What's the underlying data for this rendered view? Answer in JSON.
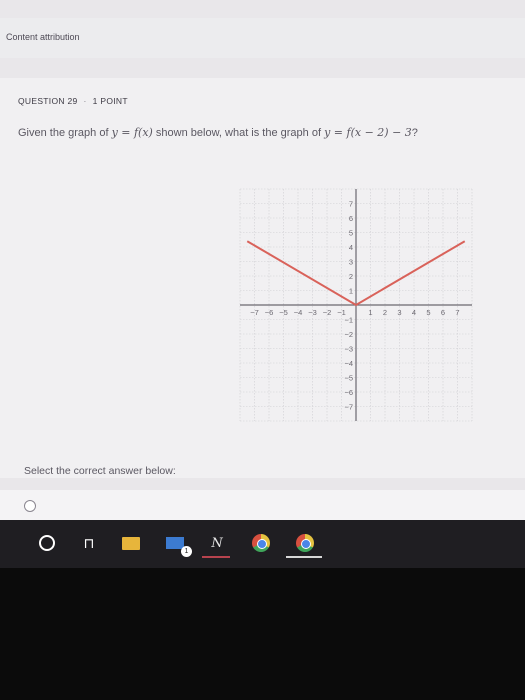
{
  "header": {
    "attribution": "Content attribution"
  },
  "question": {
    "number_label": "QUESTION 29",
    "points_label": "1 POINT",
    "text_prefix": "Given the graph of ",
    "expr_given": "y = f(x)",
    "text_middle": " shown below, what is the graph of ",
    "expr_target": "y = f(x − 2) − 3",
    "text_suffix": "?"
  },
  "answer_section": {
    "select_label": "Select the correct answer below:"
  },
  "taskbar": {
    "items": [
      "cortana-icon",
      "task-view-icon",
      "file-explorer-icon",
      "mail-icon",
      "onenote-icon",
      "chrome-icon",
      "chrome-icon"
    ],
    "mail_badge": "1",
    "notes_letter": "N",
    "taskview_glyph": "⊓"
  },
  "colors": {
    "curve": "#d9625a",
    "axis": "#6b6870",
    "grid": "#cfcdd2",
    "background": "#f1f0f2"
  },
  "chart_data": {
    "type": "line",
    "xlim": [
      -8,
      8
    ],
    "ylim": [
      -8,
      8
    ],
    "x_ticks": [
      -7,
      -6,
      -5,
      -4,
      -3,
      -2,
      -1,
      1,
      2,
      3,
      4,
      5,
      6,
      7
    ],
    "y_ticks": [
      7,
      6,
      5,
      4,
      3,
      2,
      1,
      -1,
      -2,
      -3,
      -4,
      -5,
      -6,
      -7
    ],
    "grid": true,
    "series": [
      {
        "x": [
          -7.5,
          0,
          7.5
        ],
        "y": [
          4.4,
          0,
          4.4
        ]
      }
    ]
  }
}
